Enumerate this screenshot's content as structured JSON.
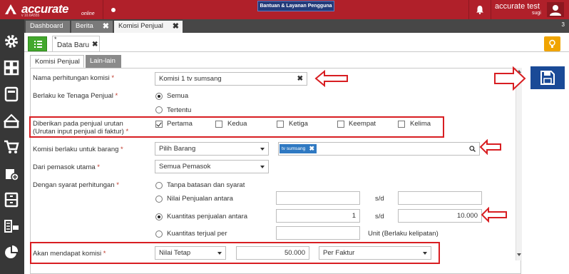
{
  "app": {
    "logo": "accurate",
    "logo_sub": "online",
    "version": "v 10.6A555",
    "help_button": "Bantuan & Layanan Pengguna",
    "user_name": "accurate test",
    "user_sub": "sugi"
  },
  "tabs": [
    {
      "label": "Dashboard"
    },
    {
      "label": "Berita",
      "close": "✖"
    },
    {
      "label": "Komisi Penjual",
      "close": "✖"
    }
  ],
  "tab_count": "3",
  "document": {
    "tab_star": "*",
    "tab_label": "Data Baru",
    "tab_close": "✖"
  },
  "subtabs": [
    "Komisi Penjual",
    "Lain-lain"
  ],
  "form": {
    "nama_label": "Nama perhitungan komisi",
    "nama_value": "Komisi 1 tv sumsang",
    "berlaku_label": "Berlaku ke Tenaga Penjual",
    "berlaku_options": [
      "Semua",
      "Tertentu"
    ],
    "urutan_label_1": "Diberikan pada penjual urutan",
    "urutan_label_2": "(Urutan input penjual di faktur)",
    "urutan_options": [
      {
        "label": "Pertama",
        "checked": true
      },
      {
        "label": "Kedua",
        "checked": false
      },
      {
        "label": "Ketiga",
        "checked": false
      },
      {
        "label": "Keempat",
        "checked": false
      },
      {
        "label": "Kelima",
        "checked": false
      }
    ],
    "barang_label": "Komisi berlaku untuk barang",
    "barang_select": "Pilih Barang",
    "barang_chip": "tv sumsang",
    "pemasok_label": "Dari pemasok utama",
    "pemasok_select": "Semua Pemasok",
    "syarat_label": "Dengan syarat perhitungan",
    "syarat_options": [
      {
        "label": "Tanpa batasan dan syarat",
        "selected": false
      },
      {
        "label": "Nilai Penjualan antara",
        "selected": false,
        "from": "",
        "to": ""
      },
      {
        "label": "Kuantitas penjualan antara",
        "selected": true,
        "from": "1",
        "to": "10.000"
      },
      {
        "label": "Kuantitas terjual per",
        "selected": false,
        "value": "",
        "suffix": "Unit (Berlaku kelipatan)"
      }
    ],
    "sd_label": "s/d",
    "komisi_label": "Akan mendapat komisi",
    "komisi_type": "Nilai Tetap",
    "komisi_value": "50.000",
    "komisi_per": "Per Faktur",
    "required_mark": "*"
  },
  "colors": {
    "brand_red": "#b0202a",
    "annotation_red": "#d81e22",
    "save_blue": "#1a4a97",
    "chip_blue": "#2f79c2"
  }
}
